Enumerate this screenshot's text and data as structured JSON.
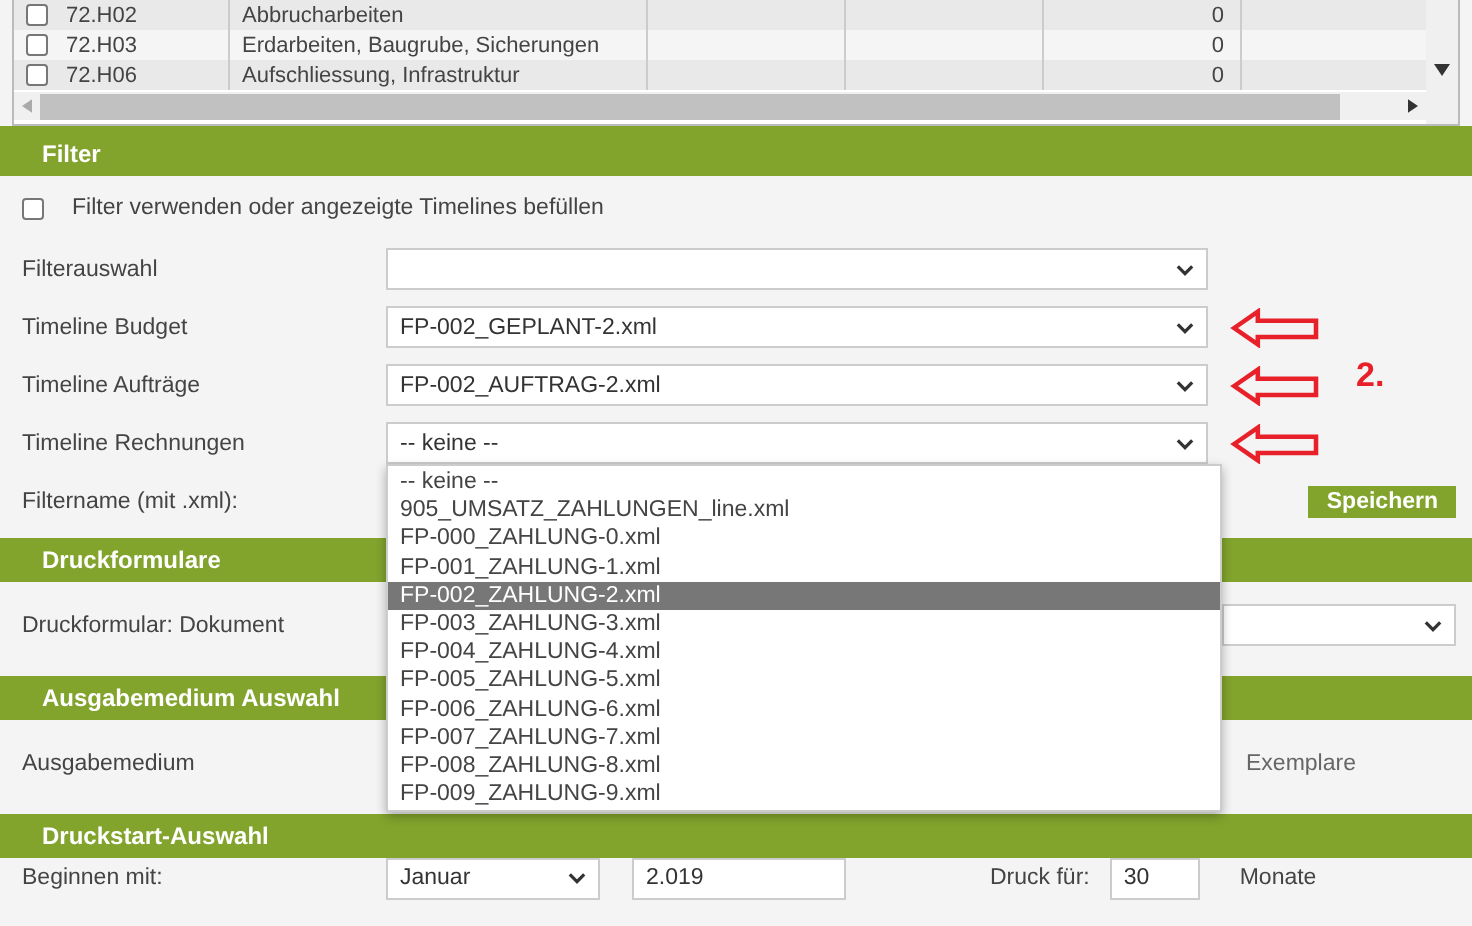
{
  "table": {
    "rows": [
      {
        "code": "72.H02",
        "description": "Abbrucharbeiten",
        "value": "0",
        "checked": false
      },
      {
        "code": "72.H03",
        "description": "Erdarbeiten, Baugrube, Sicherungen",
        "value": "0",
        "checked": false
      },
      {
        "code": "72.H06",
        "description": "Aufschliessung, Infrastruktur",
        "value": "0",
        "checked": false
      }
    ]
  },
  "filter": {
    "title": "Filter",
    "use_filter": {
      "label": "Filter verwenden oder angezeigte Timelines befüllen",
      "checked": false
    },
    "fields": [
      {
        "label": "Filterauswahl",
        "annotated": false
      },
      {
        "label": "Timeline Budget",
        "value": "FP-002_GEPLANT-2.xml",
        "annotated": true
      },
      {
        "label": "Timeline Aufträge",
        "value": "FP-002_AUFTRAG-2.xml",
        "annotated": true
      },
      {
        "label": "Timeline Rechnungen",
        "value": "-- keine --",
        "annotated": true
      }
    ],
    "annotation": "2.",
    "filtername": {
      "label": "Filtername (mit .xml):",
      "button": "Speichern"
    },
    "dropdown": [
      {
        "label": "-- keine --",
        "selected": false
      },
      {
        "label": "905_UMSATZ_ZAHLUNGEN_line.xml",
        "selected": false
      },
      {
        "label": "FP-000_ZAHLUNG-0.xml",
        "selected": false
      },
      {
        "label": "FP-001_ZAHLUNG-1.xml",
        "selected": false
      },
      {
        "label": "FP-002_ZAHLUNG-2.xml",
        "selected": true
      },
      {
        "label": "FP-003_ZAHLUNG-3.xml",
        "selected": false
      },
      {
        "label": "FP-004_ZAHLUNG-4.xml",
        "selected": false
      },
      {
        "label": "FP-005_ZAHLUNG-5.xml",
        "selected": false
      },
      {
        "label": "FP-006_ZAHLUNG-6.xml",
        "selected": false
      },
      {
        "label": "FP-007_ZAHLUNG-7.xml",
        "selected": false
      },
      {
        "label": "FP-008_ZAHLUNG-8.xml",
        "selected": false
      },
      {
        "label": "FP-009_ZAHLUNG-9.xml",
        "selected": false
      }
    ]
  },
  "print_forms": {
    "title": "Druckformulare",
    "label": "Druckformular: Dokument"
  },
  "output_medium": {
    "title": "Ausgabemedium Auswahl",
    "label": "Ausgabemedium",
    "label_2": "Exemplare"
  },
  "print_start": {
    "title": "Druckstart-Auswahl",
    "label": "Beginnen mit:",
    "month": "Januar",
    "year": "2.019",
    "print_for_label": "Druck für:",
    "print_for": "30",
    "unit": "Monate"
  }
}
